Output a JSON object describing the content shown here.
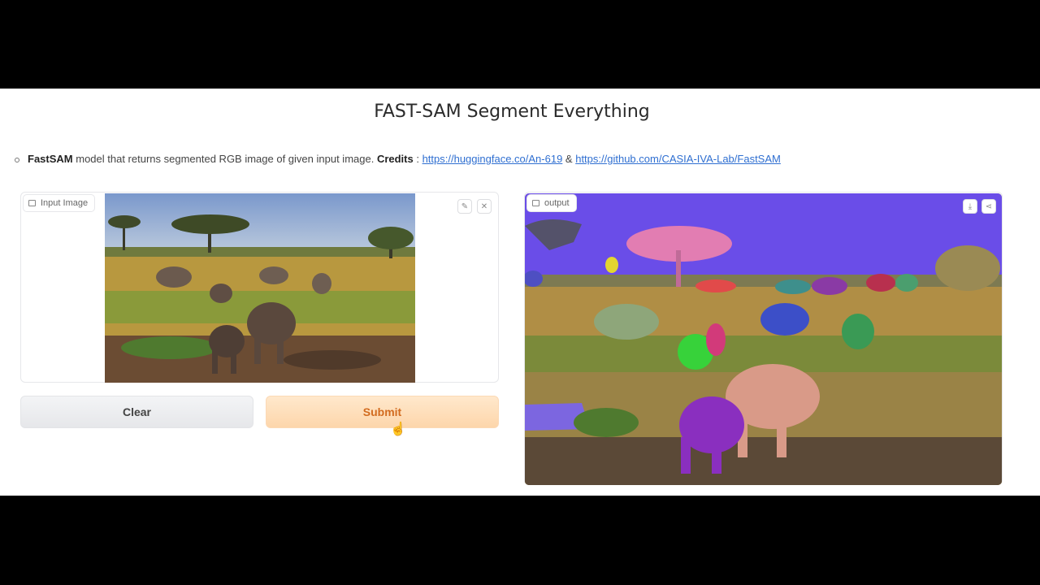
{
  "header": {
    "title": "FAST-SAM Segment Everything"
  },
  "description": {
    "model_name": "FastSAM",
    "text": " model that returns segmented RGB image of given input image. ",
    "credits_label": "Credits",
    "credits_sep": " : ",
    "link1": "https://huggingface.co/An-619",
    "amp": " & ",
    "link2": "https://github.com/CASIA-IVA-Lab/FastSAM"
  },
  "input_panel": {
    "label": "Input Image",
    "edit_icon": "pencil-icon",
    "close_icon": "close-icon"
  },
  "output_panel": {
    "label": "output",
    "download_icon": "download-icon",
    "share_icon": "share-icon"
  },
  "buttons": {
    "clear": "Clear",
    "submit": "Submit"
  },
  "colors": {
    "submit_text": "#d26b1f",
    "submit_bg": "#fdd6ab",
    "link": "#2f6fd1",
    "seg_sky": "#6a4de8"
  }
}
